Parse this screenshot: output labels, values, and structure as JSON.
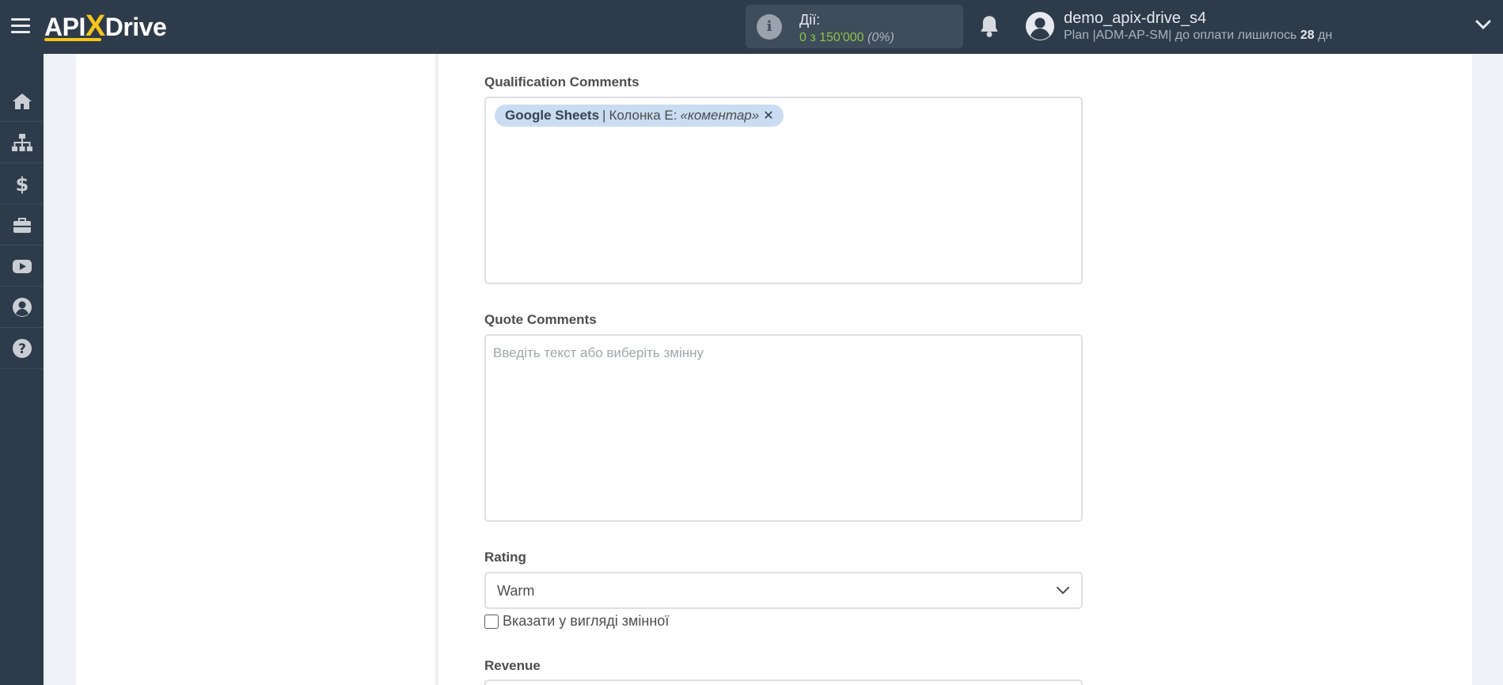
{
  "header": {
    "logo_left": "API",
    "logo_x": "X",
    "logo_right": "Drive",
    "actions_label": "Дії:",
    "actions_count": "0 з 150'000",
    "actions_percent": "(0%)",
    "user_name": "demo_apix-drive_s4",
    "plan_prefix": "Plan |ADM-AP-SM| до оплати лишилось",
    "plan_days": "28",
    "plan_suffix": "дн"
  },
  "sidebar": {
    "items": [
      {
        "icon": "home-icon"
      },
      {
        "icon": "sitemap-icon"
      },
      {
        "icon": "dollar-icon"
      },
      {
        "icon": "briefcase-icon"
      },
      {
        "icon": "youtube-icon"
      },
      {
        "icon": "user-circle-icon"
      },
      {
        "icon": "help-icon"
      }
    ]
  },
  "form": {
    "qualification_comments": {
      "label": "Qualification Comments",
      "chip": {
        "source": "Google Sheets",
        "separator": "|",
        "column": "Колонка E:",
        "variable": "«коментар»",
        "remove": "✕"
      }
    },
    "quote_comments": {
      "label": "Quote Comments",
      "placeholder": "Введіть текст або виберіть змінну"
    },
    "rating": {
      "label": "Rating",
      "value": "Warm",
      "checkbox_label": "Вказати у вигляді змінної",
      "checked": false
    },
    "revenue": {
      "label": "Revenue"
    }
  },
  "colors": {
    "topbar": "#2e3b4a",
    "accent_yellow": "#f5c518",
    "actions_green": "#8bc34a",
    "chip_bg": "#c9dcf2"
  }
}
